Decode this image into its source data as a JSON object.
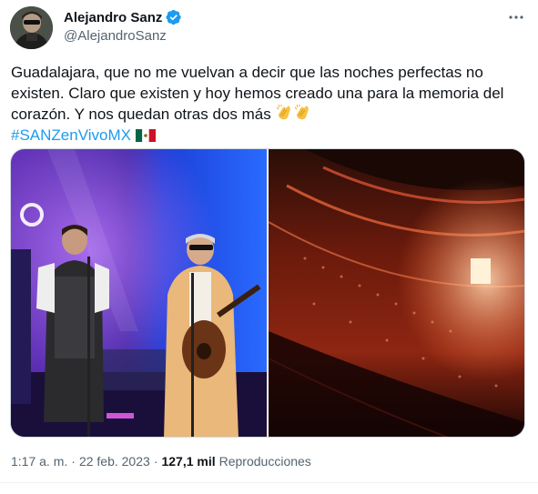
{
  "author": {
    "display_name": "Alejandro Sanz",
    "handle": "@AlejandroSanz",
    "verified": true
  },
  "tweet": {
    "text_main": "Guadalajara, que no me vuelvan a decir que las noches perfectas no existen. Claro que existen y hoy hemos creado una para la memoria del corazón. Y nos quedan otras dos más ",
    "hashtag": "#SANZenVivoMX",
    "emojis": [
      "clapping-hands-emoji",
      "clapping-hands-emoji",
      "mexico-flag-emoji"
    ]
  },
  "media": {
    "photos": [
      "concert-stage-photo",
      "arena-crowd-photo"
    ]
  },
  "meta": {
    "time": "1:17 a. m.",
    "separator": "·",
    "date": "22 feb. 2023",
    "views_count": "127,1 mil",
    "views_label": "Reproducciones"
  },
  "colors": {
    "accent": "#1d9bf0",
    "text": "#0f1419",
    "secondary": "#536471"
  }
}
